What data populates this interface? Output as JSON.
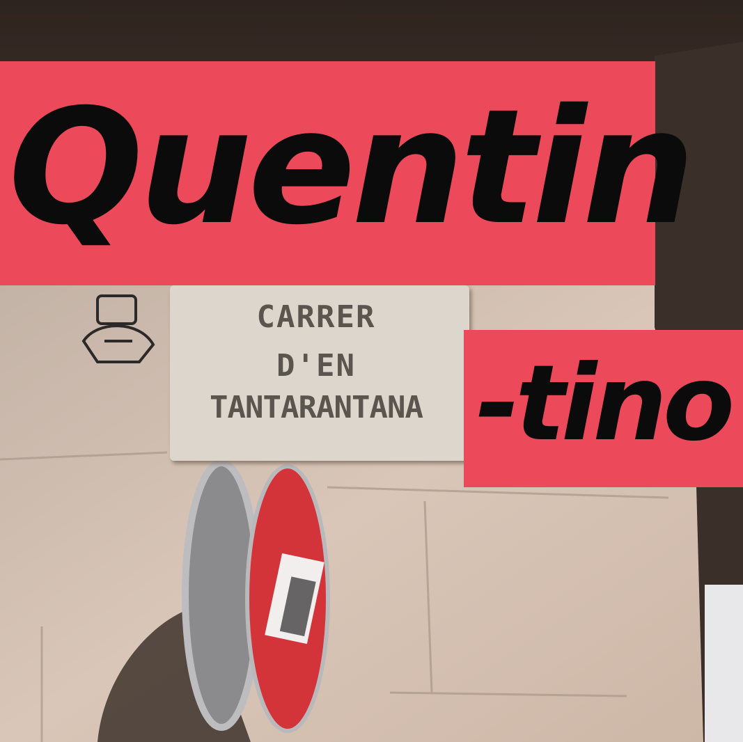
{
  "banner_top": {
    "text": "Quentin",
    "color": "#ec4a5a"
  },
  "banner_right": {
    "text": "-tino",
    "color": "#ec4a5a"
  },
  "street_sign": {
    "line1": "CARRER",
    "line2": "D'EN",
    "line3": "TANTARANTANA"
  },
  "icons": [
    "stencil-graffiti",
    "no-entry-sign"
  ]
}
